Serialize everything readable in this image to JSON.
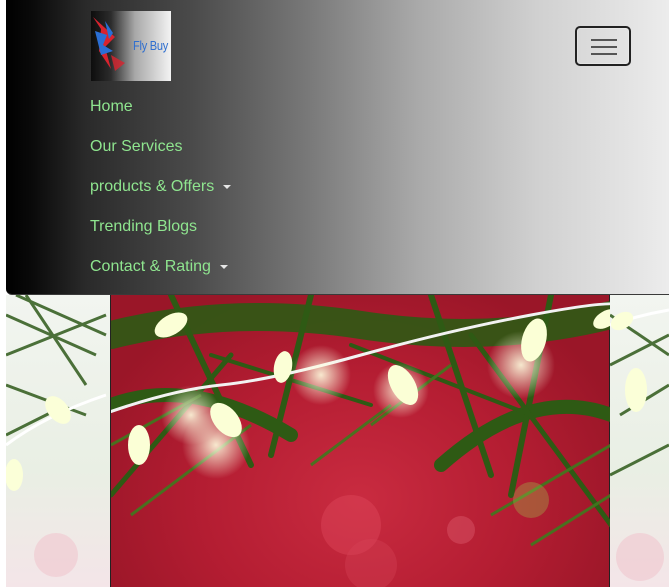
{
  "brand": {
    "logo_text": "Fly Buy"
  },
  "navbar": {
    "toggler_icon": "hamburger-icon",
    "items": [
      {
        "label": "Home",
        "dropdown": false
      },
      {
        "label": "Our Services",
        "dropdown": false
      },
      {
        "label": "products & Offers",
        "dropdown": true
      },
      {
        "label": "Trending Blogs",
        "dropdown": false
      },
      {
        "label": "Contact & Rating",
        "dropdown": true
      }
    ]
  },
  "colors": {
    "nav_link": "#8fe58f",
    "hero_red": "#b41d32",
    "foliage": "#2f5a1a"
  }
}
